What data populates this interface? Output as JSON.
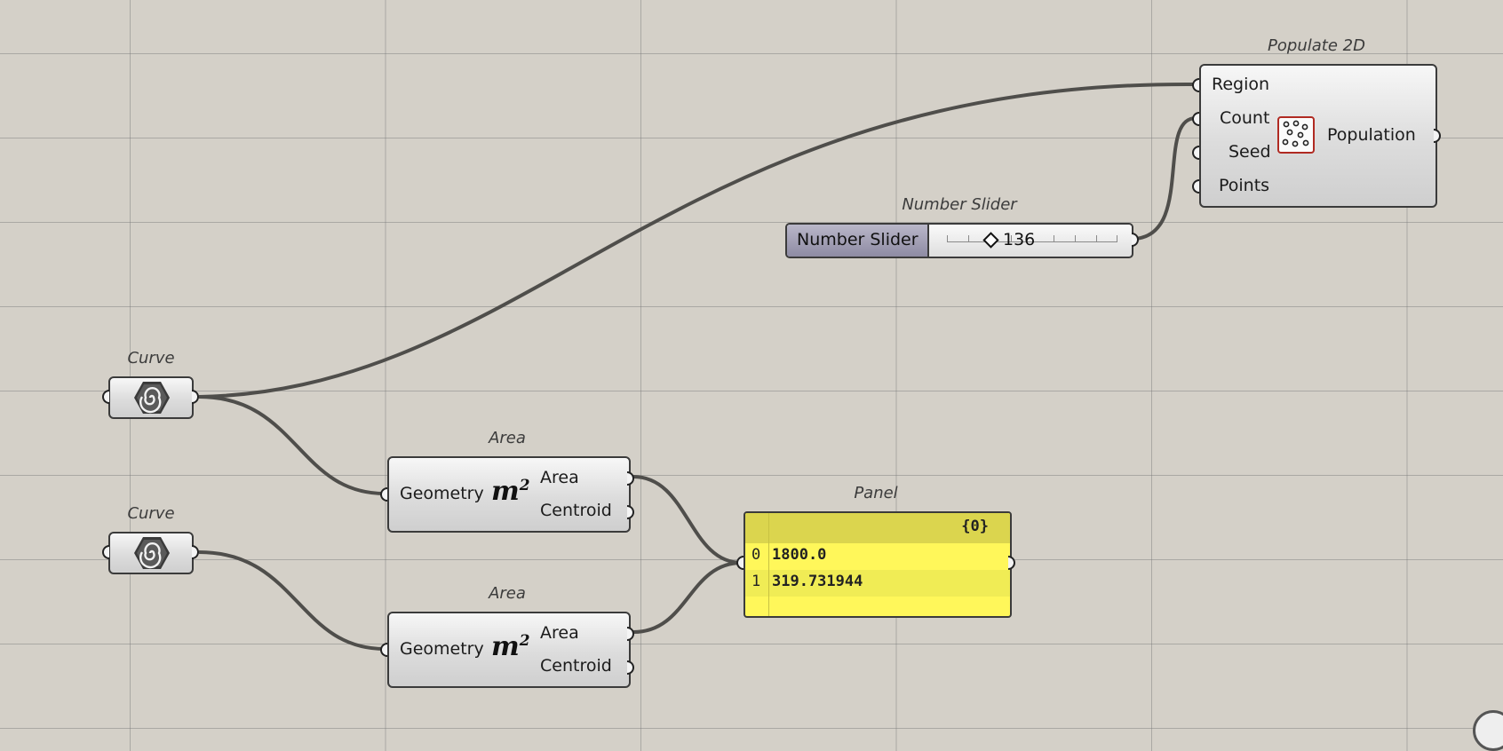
{
  "canvas": {
    "background": "#d4d0c8",
    "wire_color": "#4f4e4b",
    "panel_color": "#fff75a",
    "slider_color": "#9a97ae"
  },
  "curve1": {
    "nickname": "Curve",
    "icon": "curve-param-icon"
  },
  "curve2": {
    "nickname": "Curve",
    "icon": "curve-param-icon"
  },
  "area1": {
    "nickname": "Area",
    "input": "Geometry",
    "icon_text": "m",
    "icon_sup": "2",
    "outputs": [
      "Area",
      "Centroid"
    ]
  },
  "area2": {
    "nickname": "Area",
    "input": "Geometry",
    "icon_text": "m",
    "icon_sup": "2",
    "outputs": [
      "Area",
      "Centroid"
    ]
  },
  "slider": {
    "nickname": "Number Slider",
    "name": "Number Slider",
    "value": "136"
  },
  "populate": {
    "nickname": "Populate 2D",
    "inputs": [
      "Region",
      "Count",
      "Seed",
      "Points"
    ],
    "output": "Population",
    "icon": "populate-2d-icon"
  },
  "panel": {
    "nickname": "Panel",
    "path": "{0}",
    "rows": [
      {
        "index": "0",
        "value": "1800.0"
      },
      {
        "index": "1",
        "value": "319.731944"
      }
    ]
  }
}
